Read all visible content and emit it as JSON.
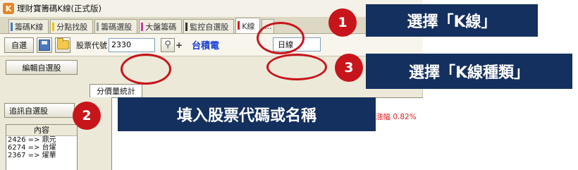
{
  "window": {
    "title": "理財寶籌碼K線(正式版)",
    "app_icon_glyph": "K"
  },
  "tabs": [
    {
      "label": "籌碼K線",
      "color": "#3a7bd5",
      "active": false
    },
    {
      "label": "分點找股",
      "color": "#f2c200",
      "active": false
    },
    {
      "label": "籌碼選股",
      "color": "#999999",
      "active": false
    },
    {
      "label": "大盤籌碼",
      "color": "#cc3aa8",
      "active": false
    },
    {
      "label": "監控自選股",
      "color": "#333333",
      "active": false
    },
    {
      "label": "K線",
      "color": "#e01515",
      "active": true
    },
    {
      "label": "...",
      "color": "#999999",
      "active": false
    }
  ],
  "toolbar": {
    "watchlist_button": "自選",
    "save_icon": "save-icon",
    "open_icon": "folder-icon",
    "code_label": "股票代號",
    "code_value": "2330",
    "search_icon": "magnifier-icon",
    "plus_label": "+",
    "stock_name": "台積電",
    "chart_type_value": "日線"
  },
  "left_panel": {
    "edit_button": "編輯自選股",
    "track_button": "追訊自選股",
    "list_header": "內容",
    "list_items": [
      "2426 => 鼎元",
      "6274 => 台燿",
      "2367 => 燿華"
    ]
  },
  "main": {
    "dist_tab": "分價量統計",
    "change_text": "漲幅 0.82%"
  },
  "annotations": {
    "step1_number": "1",
    "step1_text": "選擇「K線」",
    "step2_number": "2",
    "step2_text": "填入股票代碼或名稱",
    "step3_number": "3",
    "step3_text": "選擇「K線種類」"
  },
  "colors": {
    "annotation_red": "#c8141b",
    "callout_navy": "#14305f",
    "stock_name_blue": "#1a3fd6"
  }
}
